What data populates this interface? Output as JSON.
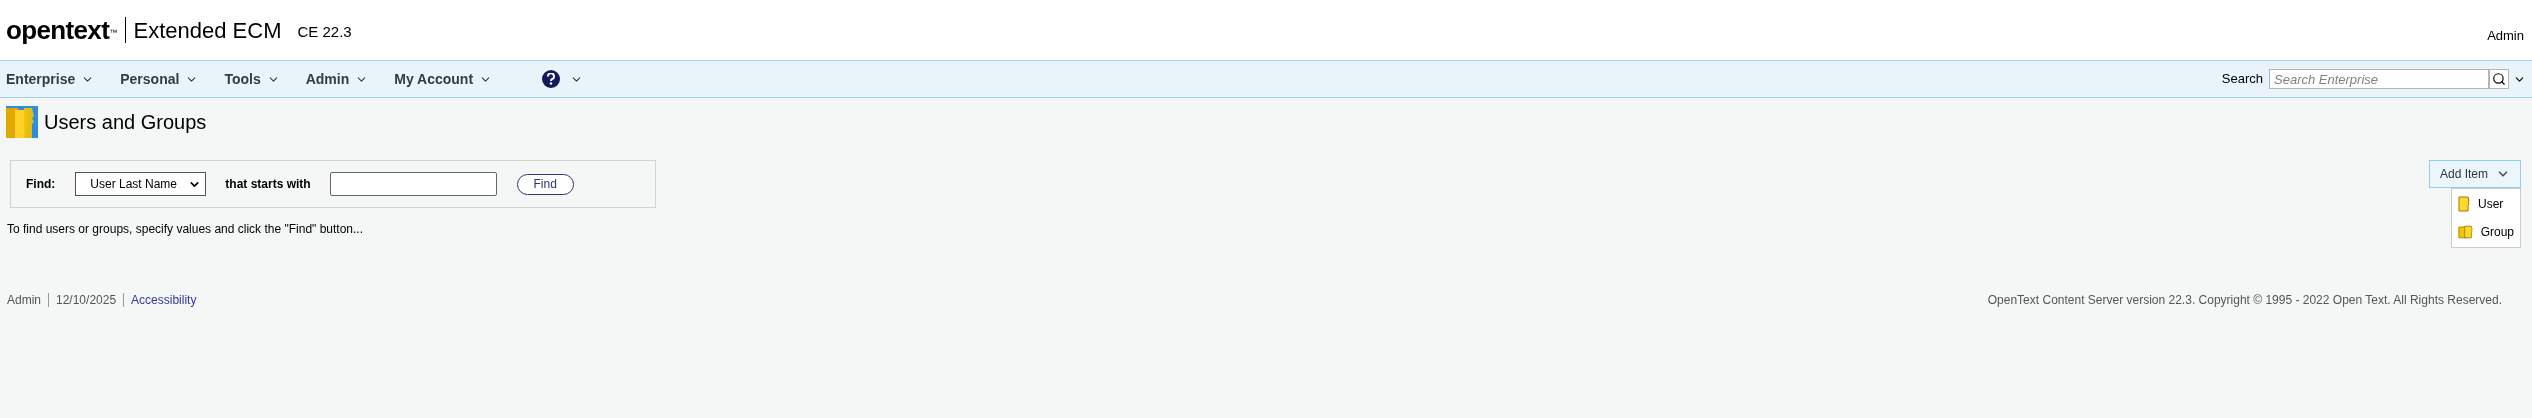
{
  "header": {
    "logo": "opentext",
    "logo_mark": "™",
    "product": "Extended ECM",
    "version": "CE 22.3",
    "user": "Admin"
  },
  "nav": {
    "menus": [
      {
        "label": "Enterprise"
      },
      {
        "label": "Personal"
      },
      {
        "label": "Tools"
      },
      {
        "label": "Admin"
      },
      {
        "label": "My Account"
      }
    ],
    "search_label": "Search",
    "search_placeholder": "Search Enterprise"
  },
  "page": {
    "title": "Users and Groups"
  },
  "find": {
    "label": "Find:",
    "field": "User Last Name",
    "operator": "that starts with",
    "button": "Find"
  },
  "hint": "To find users or groups, specify values and click the \"Find\" button...",
  "add_item": {
    "label": "Add Item",
    "expanded": true,
    "items": [
      {
        "label": "User",
        "kind": "user"
      },
      {
        "label": "Group",
        "kind": "group"
      }
    ]
  },
  "footer": {
    "user": "Admin",
    "date": "12/10/2025",
    "link": "Accessibility",
    "copyright": "OpenText Content Server version 22.3. Copyright © 1995 - 2022 Open Text. All Rights Reserved."
  }
}
